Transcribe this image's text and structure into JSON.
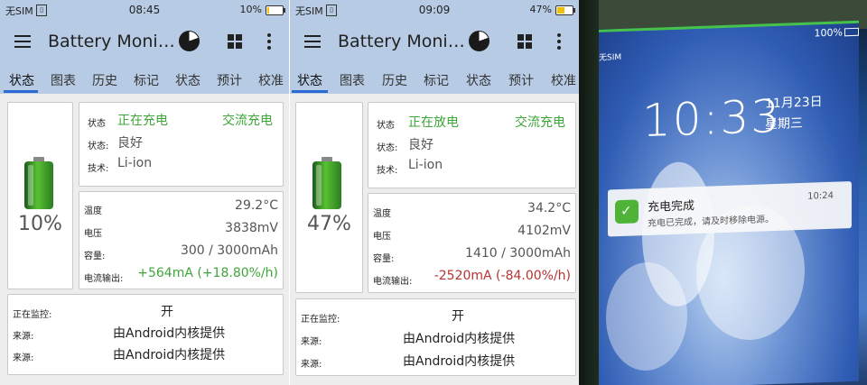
{
  "panels": [
    {
      "status_bar": {
        "carrier": "无SIM",
        "time": "08:45",
        "battery_pct": "10%",
        "battery_level": 0.1
      },
      "app_title": "Battery Moni…",
      "tabs": [
        "状态",
        "图表",
        "历史",
        "标记",
        "状态",
        "预计",
        "校准"
      ],
      "active_tab": 0,
      "battery_percent": "10%",
      "status": {
        "label": "状态",
        "value": "正在充电",
        "source": "交流充电"
      },
      "health": {
        "label": "状态:",
        "value": "良好"
      },
      "tech": {
        "label": "技术:",
        "value": "Li-ion"
      },
      "temperature": {
        "label": "温度",
        "value": "29.2°C"
      },
      "voltage": {
        "label": "电压",
        "value": "3838mV"
      },
      "capacity": {
        "label": "容量:",
        "value": "300 / 3000mAh"
      },
      "current": {
        "label": "电流输出:",
        "value": "+564mA (+18.80%/h)"
      },
      "monitoring": {
        "label": "正在监控:",
        "value": "开"
      },
      "sources": [
        {
          "label": "来源:",
          "value": "由Android内核提供"
        },
        {
          "label": "来源:",
          "value": "由Android内核提供"
        }
      ]
    },
    {
      "status_bar": {
        "carrier": "无SIM",
        "time": "09:09",
        "battery_pct": "47%",
        "battery_level": 0.47
      },
      "app_title": "Battery Moni…",
      "tabs": [
        "状态",
        "图表",
        "历史",
        "标记",
        "状态",
        "预计",
        "校准"
      ],
      "active_tab": 0,
      "battery_percent": "47%",
      "status": {
        "label": "状态",
        "value": "正在放电",
        "source": "交流充电"
      },
      "health": {
        "label": "状态:",
        "value": "良好"
      },
      "tech": {
        "label": "技术:",
        "value": "Li-ion"
      },
      "temperature": {
        "label": "温度",
        "value": "34.2°C"
      },
      "voltage": {
        "label": "电压",
        "value": "4102mV"
      },
      "capacity": {
        "label": "容量:",
        "value": "1410 / 3000mAh"
      },
      "current": {
        "label": "电流输出:",
        "value": "-2520mA (-84.00%/h)"
      },
      "monitoring": {
        "label": "正在监控:",
        "value": "开"
      },
      "sources": [
        {
          "label": "来源:",
          "value": "由Android内核提供"
        },
        {
          "label": "来源:",
          "value": "由Android内核提供"
        }
      ]
    }
  ],
  "lockscreen": {
    "carrier": "无SIM",
    "battery_pct": "100%",
    "time": "10:33",
    "date": "11月23日",
    "weekday": "星期三",
    "notification": {
      "title": "充电完成",
      "body": "充电已完成，请及时移除电源。",
      "time": "10:24"
    }
  },
  "colors": {
    "appbar": "#b8cbe4",
    "accent": "#2c6bd3",
    "charging": "#3ea63a",
    "discharging": "#b83232"
  }
}
